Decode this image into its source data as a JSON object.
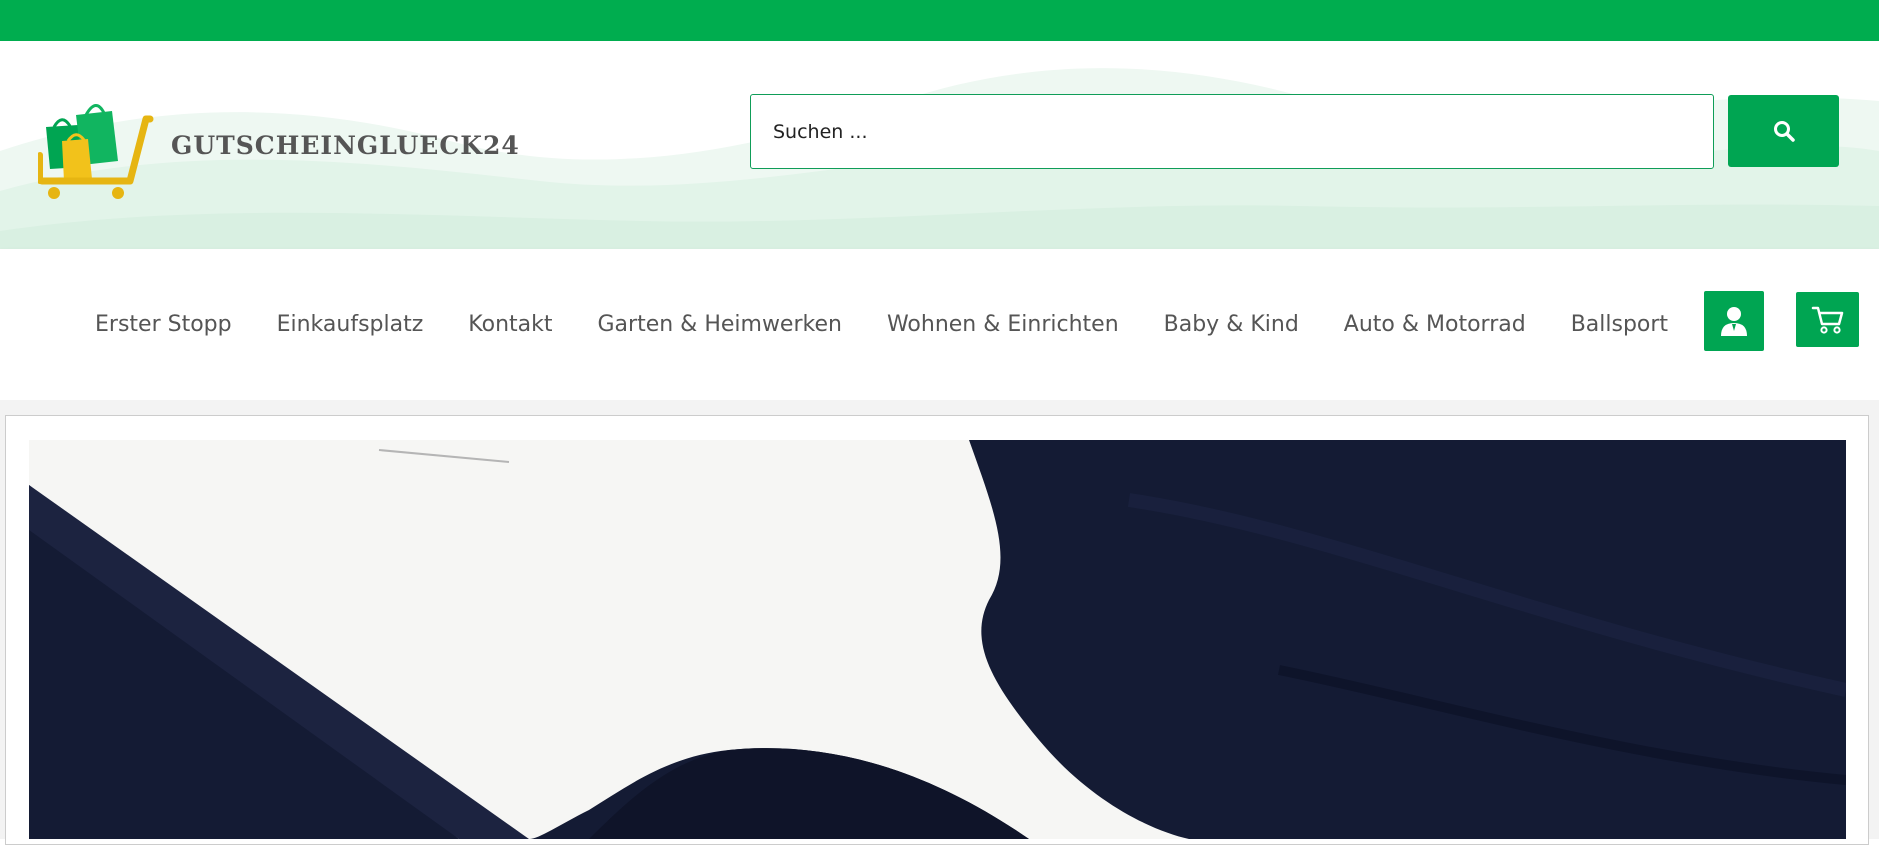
{
  "site": {
    "brand_name": "GUTSCHEINGLUECK24",
    "logo_icon": "shopping-cart-with-bags",
    "colors": {
      "accent": "#00ad4f",
      "button": "#00a552",
      "cart_yellow": "#e6b512",
      "text": "#555555"
    }
  },
  "search": {
    "placeholder": "Suchen ...",
    "button_icon": "search-icon"
  },
  "nav": {
    "items": [
      {
        "label": "Erster Stopp"
      },
      {
        "label": "Einkaufsplatz"
      },
      {
        "label": "Kontakt"
      },
      {
        "label": "Garten & Heimwerken"
      },
      {
        "label": "Wohnen & Einrichten"
      },
      {
        "label": "Baby & Kind"
      },
      {
        "label": "Auto & Motorrad"
      },
      {
        "label": "Ballsport"
      }
    ],
    "account_icon": "user-icon",
    "cart_icon": "cart-icon"
  },
  "hero": {
    "image_desc": "close-up of navy fabric with white paper card"
  }
}
